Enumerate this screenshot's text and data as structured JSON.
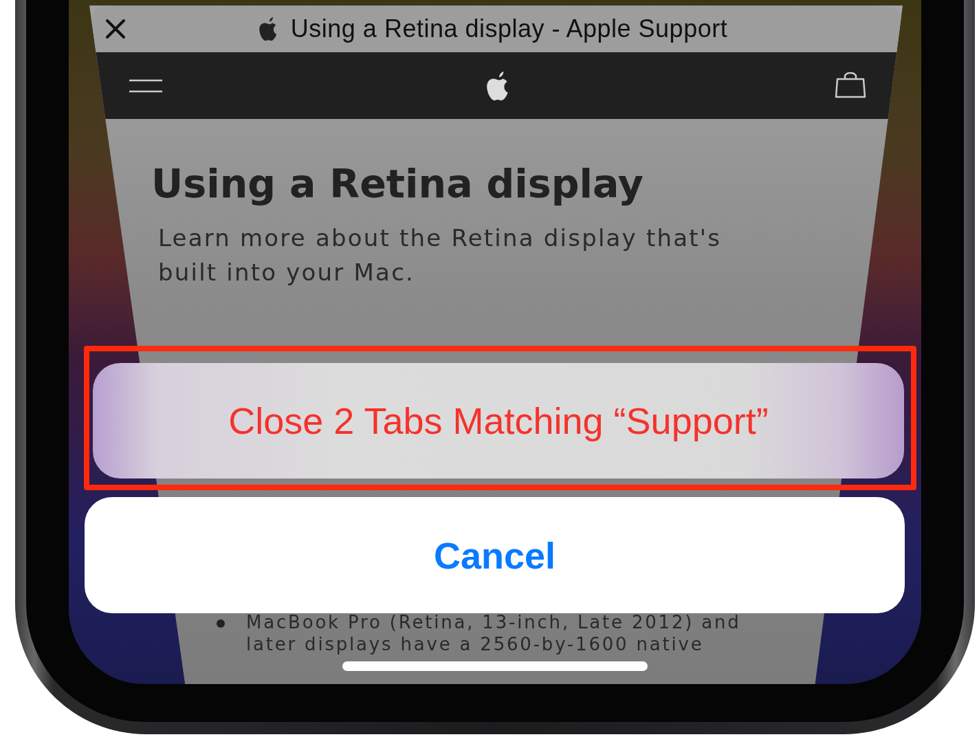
{
  "tab_card": {
    "title": "Using a Retina display - Apple Support",
    "page": {
      "heading": "Using a Retina display",
      "intro": "Learn more about the Retina display that's built into your Mac.",
      "bullets": [
        "MacBook Pro (Retina, 13-inch, Late 2012) and later displays have a 2560-by-1600 native"
      ]
    }
  },
  "action_sheet": {
    "actions": [
      {
        "label": "Close 2 Tabs Matching “Support”",
        "kind": "destructive",
        "highlighted": true
      },
      {
        "label": "Cancel",
        "kind": "cancel",
        "highlighted": false
      }
    ]
  }
}
